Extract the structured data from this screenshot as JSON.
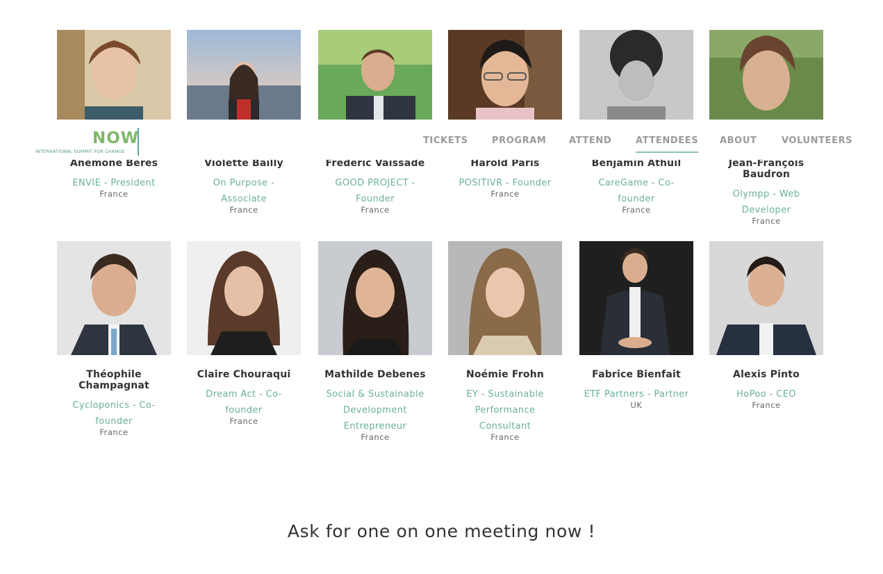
{
  "header": {
    "logo_text": "NOW",
    "logo_sub": "INTERNATIONAL SUMMIT FOR CHANGE",
    "nav": [
      {
        "label": "TICKETS",
        "active": false
      },
      {
        "label": "PROGRAM",
        "active": false
      },
      {
        "label": "ATTEND",
        "active": false
      },
      {
        "label": "ATTENDEES",
        "active": true
      },
      {
        "label": "ABOUT",
        "active": false
      },
      {
        "label": "VOLUNTEERS",
        "active": false
      }
    ]
  },
  "attendees_row1": [
    {
      "name": "Anémone Bérès",
      "role": "ENVIE - President",
      "country": "France"
    },
    {
      "name": "Violette Bailly",
      "role": "On Purpose - Associate",
      "country": "France"
    },
    {
      "name": "Frédéric Vaissade",
      "role": "GOOD PROJECT - Founder",
      "country": "France"
    },
    {
      "name": "Harold Paris",
      "role": "POSITIVR - Founder",
      "country": "France"
    },
    {
      "name": "Benjamin Athuil",
      "role": "CareGame - Co-founder",
      "country": "France"
    },
    {
      "name": "Jean-François Baudron",
      "role": "Olympp - Web Developer",
      "country": "France"
    }
  ],
  "attendees_row2": [
    {
      "name": "Théophile Champagnat",
      "role": "Cycloponics - Co-founder",
      "country": "France"
    },
    {
      "name": "Claire Chouraqui",
      "role": "Dream Act - Co-founder",
      "country": "France"
    },
    {
      "name": "Mathilde Debenes",
      "role": "Social & Sustainable Development Entrepreneur",
      "country": "France"
    },
    {
      "name": "Noémie Frohn",
      "role": "EY - Sustainable Performance Consultant",
      "country": "France"
    },
    {
      "name": "Fabrice Bienfait",
      "role": "ETF Partners - Partner",
      "country": "UK"
    },
    {
      "name": "Alexis Pinto",
      "role": "HoPoo - CEO",
      "country": "France"
    }
  ],
  "cta": "Ask for one on one meeting now !",
  "colors": {
    "accent": "#6ab09a",
    "nav": "#9a9a9a",
    "text": "#333333"
  }
}
